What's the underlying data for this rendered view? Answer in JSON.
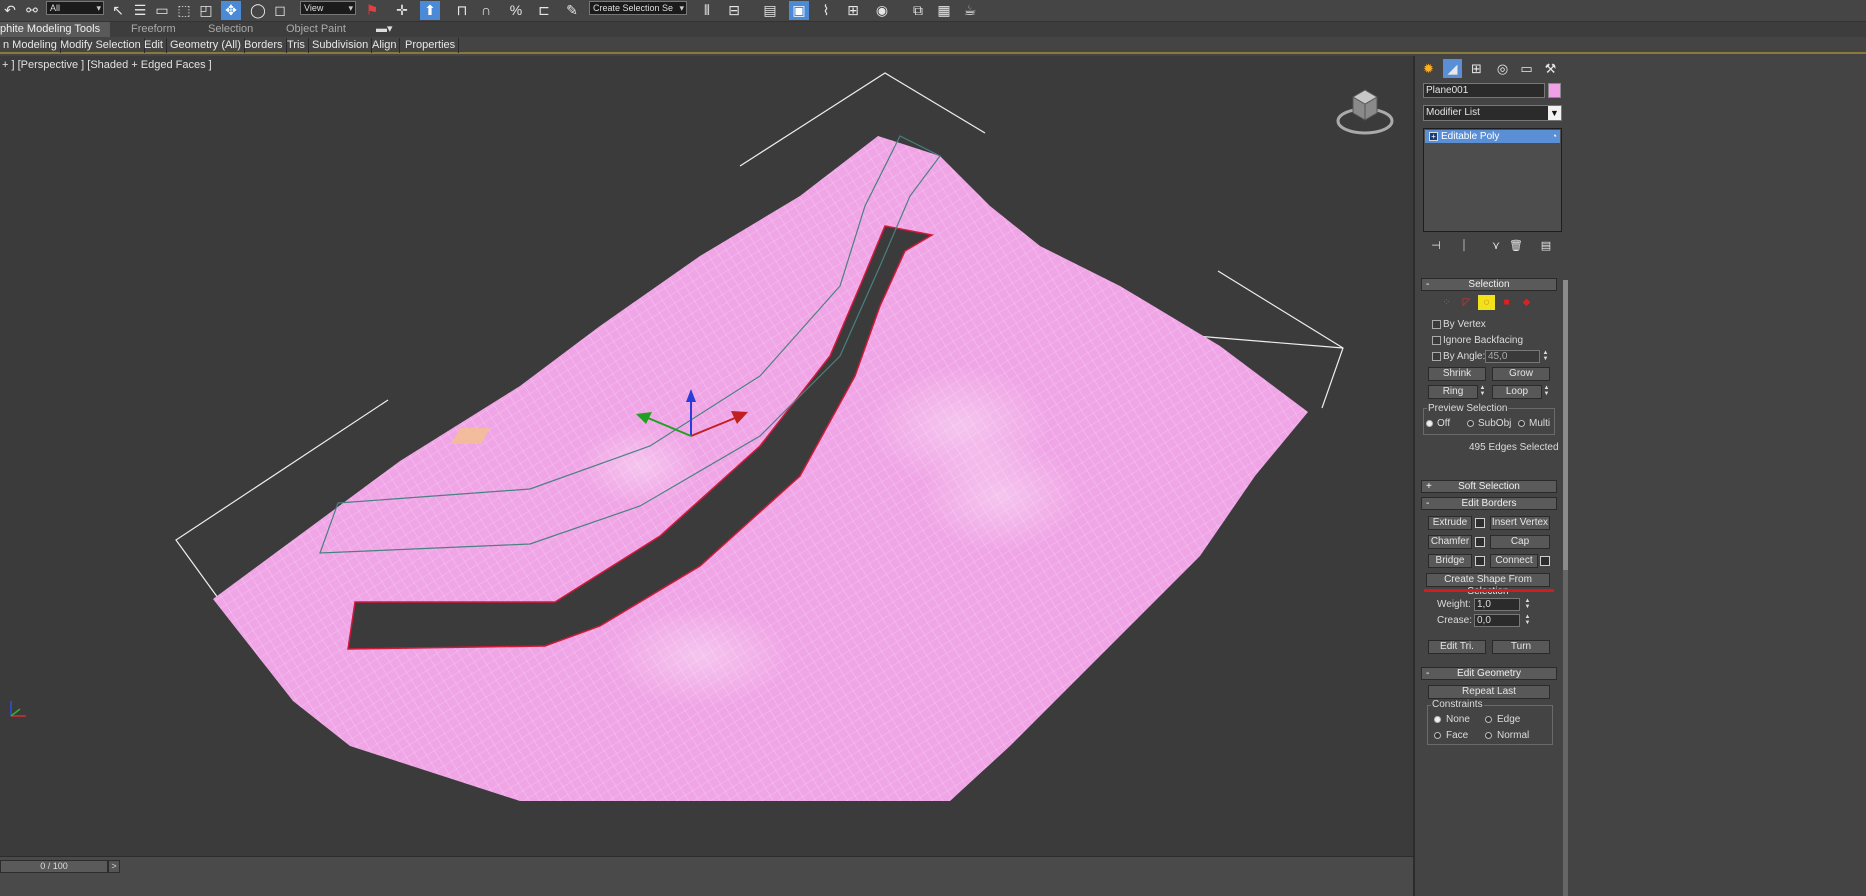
{
  "toolbar": {
    "selection_filter": "All",
    "reference_coord": "View",
    "named_selection": "Create Selection Se"
  },
  "ribbon": {
    "tabs": [
      "phite Modeling Tools",
      "Freeform",
      "Selection",
      "Object Paint"
    ],
    "subtabs": [
      "n Modeling",
      "Modify Selection",
      "Edit",
      "Geometry (All)",
      "Borders",
      "Tris",
      "Subdivision",
      "Align",
      "Properties"
    ]
  },
  "viewport": {
    "label": "+ ] [Perspective ] [Shaded + Edged Faces ]",
    "axis_labels": {
      "x": "x",
      "y": "y",
      "z": "z"
    },
    "mesh_color": "#f0a6e6",
    "selection_color": "#d01a3a"
  },
  "timeline": {
    "frame": "0 / 100",
    "next": ">"
  },
  "command_panel": {
    "tab_icons": [
      "create-icon",
      "modify-icon",
      "hierarchy-icon",
      "motion-icon",
      "display-icon",
      "utilities-icon"
    ],
    "object_name": "Plane001",
    "object_color": "#f1a0e8",
    "modifier_list": "Modifier List",
    "stack": [
      {
        "label": "Editable Poly"
      }
    ],
    "selection": {
      "title": "Selection",
      "by_vertex": "By Vertex",
      "ignore_backfacing": "Ignore Backfacing",
      "by_angle": "By Angle:",
      "angle_value": "45,0",
      "shrink": "Shrink",
      "grow": "Grow",
      "ring": "Ring",
      "loop": "Loop",
      "preview_selection": "Preview Selection",
      "preview_off": "Off",
      "preview_subobj": "SubObj",
      "preview_multi": "Multi",
      "status": "495 Edges Selected"
    },
    "soft_selection": {
      "title": "Soft Selection"
    },
    "edit_borders": {
      "title": "Edit Borders",
      "extrude": "Extrude",
      "insert_vertex": "Insert Vertex",
      "chamfer": "Chamfer",
      "cap": "Cap",
      "bridge": "Bridge",
      "connect": "Connect",
      "create_shape": "Create Shape From Selection",
      "weight_label": "Weight:",
      "weight_value": "1,0",
      "crease_label": "Crease:",
      "crease_value": "0,0",
      "edit_tri": "Edit Tri.",
      "turn": "Turn"
    },
    "edit_geometry": {
      "title": "Edit Geometry",
      "repeat_last": "Repeat Last",
      "constraints": "Constraints",
      "none": "None",
      "edge": "Edge",
      "face": "Face",
      "normal": "Normal"
    }
  }
}
